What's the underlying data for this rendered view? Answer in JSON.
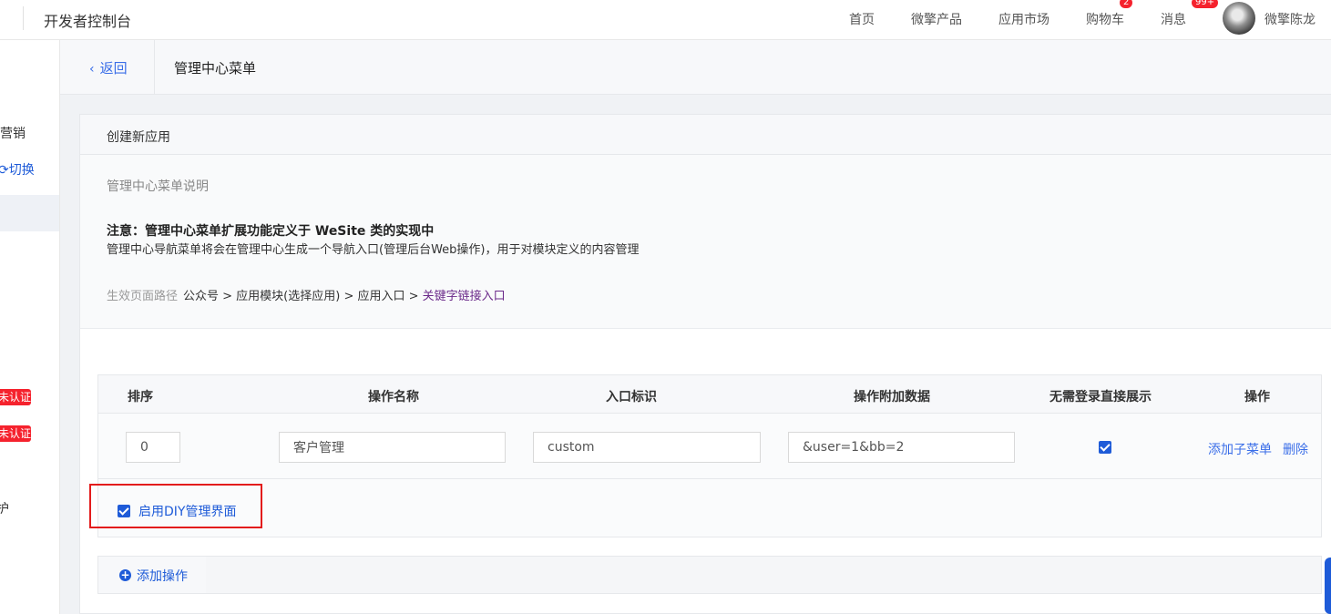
{
  "topbar": {
    "title": "开发者控制台",
    "nav": [
      "首页",
      "微擎产品",
      "应用市场",
      "购物车",
      "消息"
    ],
    "cart_badge": "2",
    "message_badge": "99+",
    "username": "微擎陈龙"
  },
  "sidebar": {
    "item_marketing": "营销",
    "item_switch": "⟳切换",
    "tag_1": "未认证",
    "tag_2": "未认证",
    "item_maintain": "护"
  },
  "header": {
    "back_label": "返回",
    "page_title": "管理中心菜单"
  },
  "card": {
    "title": "创建新应用",
    "desc_heading": "管理中心菜单说明",
    "notice": "注意：管理中心菜单扩展功能定义于 WeSite 类的实现中",
    "notice_detail": "管理中心导航菜单将会在管理中心生成一个导航入口(管理后台Web操作)，用于对模块定义的内容管理",
    "path_label": "生效页面路径",
    "path": "公众号 > 应用模块(选择应用) > 应用入口 > ",
    "path_last": "关键字链接入口"
  },
  "table": {
    "headers": [
      "排序",
      "操作名称",
      "入口标识",
      "操作附加数据",
      "无需登录直接展示",
      "操作"
    ],
    "row": {
      "sort": "0",
      "name": "客户管理",
      "entry": "custom",
      "extra": "&user=1&bb=2",
      "no_login": true,
      "action_add": "添加子菜单",
      "action_delete": "删除"
    },
    "diy_label": "启用DIY管理界面"
  },
  "add_operation": "添加操作",
  "colors": {
    "primary": "#1e5bd8",
    "link": "#3a6ee8",
    "danger": "#f5222d",
    "highlight_border": "#e31c1c"
  }
}
